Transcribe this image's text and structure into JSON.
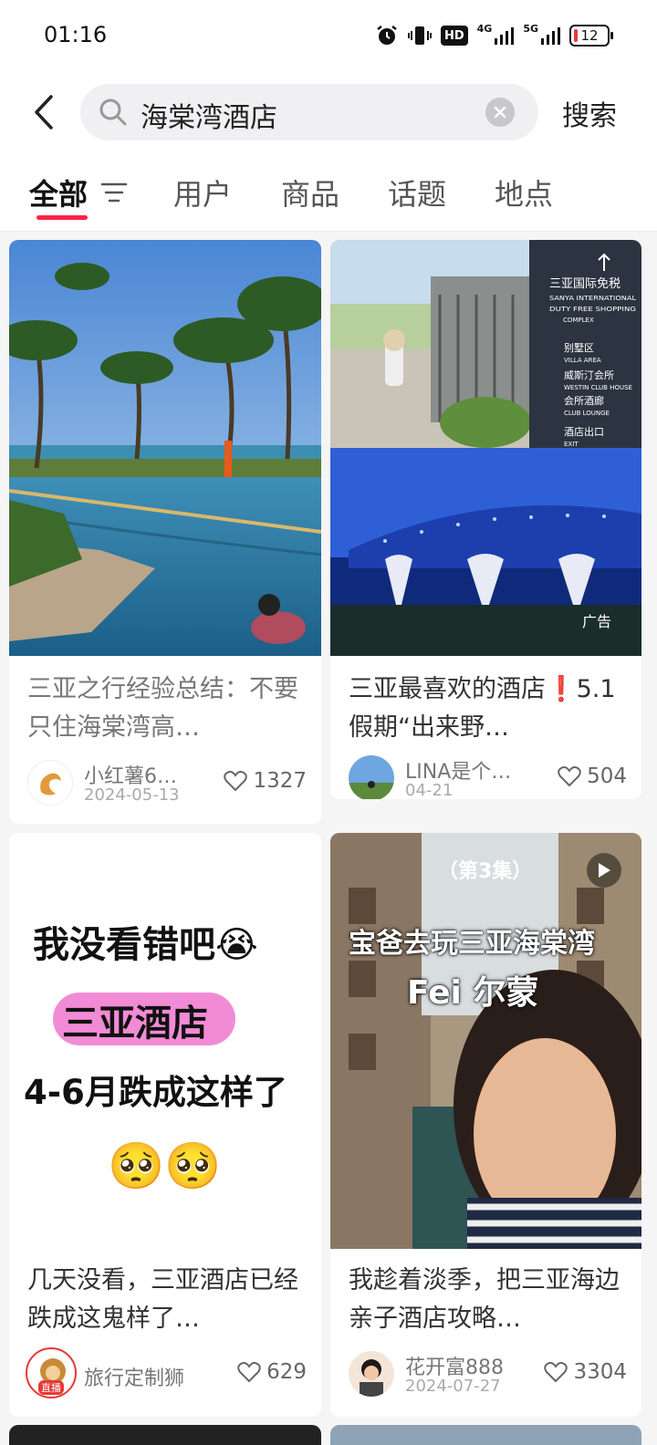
{
  "status": {
    "time": "01:16",
    "signal1": "4G",
    "signal2": "5G",
    "hd": "HD",
    "battery": "12"
  },
  "search": {
    "query": "海棠湾酒店",
    "button": "搜索"
  },
  "tabs": [
    {
      "label": "全部"
    },
    {
      "label": "用户"
    },
    {
      "label": "商品"
    },
    {
      "label": "话题"
    },
    {
      "label": "地点"
    }
  ],
  "cards": [
    {
      "title": "三亚之行经验总结：不要只住海棠湾高…",
      "author": "小红薯6…",
      "date": "2024-05-13",
      "likes": "1327"
    },
    {
      "title": "三亚最喜欢的酒店❗️5.1假期“出来野…",
      "author": "LINA是个…",
      "date": "04-21",
      "likes": "504",
      "ad_label": "广告",
      "sign": {
        "zh": "三亚国际免税",
        "en": "SANYA INTERNATIONAL DUTY FREE SHOPPING COMPLEX",
        "items": [
          {
            "zh": "别墅区",
            "en": "VILLA AREA"
          },
          {
            "zh": "威斯汀会所",
            "en": "WESTIN CLUB HOUSE"
          },
          {
            "zh": "会所酒廊",
            "en": "CLUB LOUNGE"
          },
          {
            "zh": "酒店出口",
            "en": "EXIT"
          }
        ]
      }
    },
    {
      "title": "几天没看，三亚酒店已经跌成这鬼样了…",
      "author": "旅行定制狮",
      "likes": "629",
      "live_badge": "直播",
      "overlay": {
        "line1": "我没看错吧😭",
        "line2": "三亚酒店",
        "line3": "4-6月跌成这样了",
        "line4": "🥺🥺"
      }
    },
    {
      "title": "我趁着淡季，把三亚海边亲子酒店攻略…",
      "author": "花开富888",
      "date": "2024-07-27",
      "likes": "3304",
      "overlay": {
        "episode": "（第3集）",
        "line1": "宝爸去玩三亚海棠湾",
        "line2": "Fei 尔蒙"
      }
    }
  ]
}
